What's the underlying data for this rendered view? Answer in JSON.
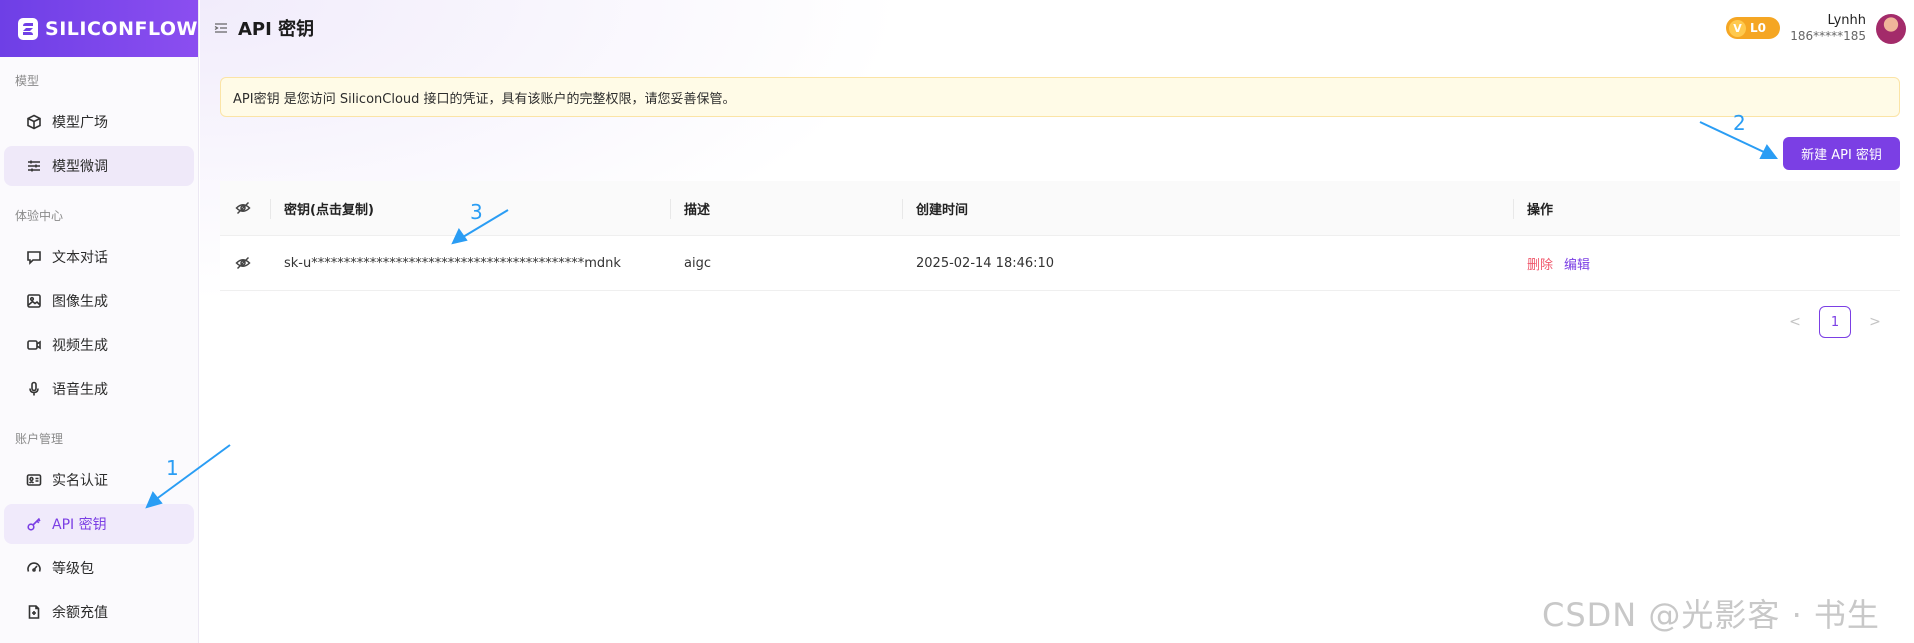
{
  "brand": {
    "name": "SILICONFLOW"
  },
  "sidebar": {
    "sections": [
      {
        "title": "模型",
        "items": [
          {
            "label": "模型广场",
            "icon": "cube-icon"
          },
          {
            "label": "模型微调",
            "icon": "sliders-icon"
          }
        ]
      },
      {
        "title": "体验中心",
        "items": [
          {
            "label": "文本对话",
            "icon": "chat-icon"
          },
          {
            "label": "图像生成",
            "icon": "image-icon"
          },
          {
            "label": "视频生成",
            "icon": "video-icon"
          },
          {
            "label": "语音生成",
            "icon": "mic-icon"
          }
        ]
      },
      {
        "title": "账户管理",
        "items": [
          {
            "label": "实名认证",
            "icon": "id-card-icon"
          },
          {
            "label": "API 密钥",
            "icon": "key-icon"
          },
          {
            "label": "等级包",
            "icon": "gauge-icon"
          },
          {
            "label": "余额充值",
            "icon": "recharge-icon"
          }
        ]
      }
    ]
  },
  "header": {
    "title": "API 密钥",
    "level": {
      "v": "V",
      "label": "L0"
    },
    "user": {
      "name": "Lynhh",
      "phone": "186*****185"
    }
  },
  "alert": {
    "text": "API密钥 是您访问 SiliconCloud 接口的凭证，具有该账户的完整权限，请您妥善保管。"
  },
  "actions": {
    "new_key": "新建 API 密钥"
  },
  "table": {
    "columns": [
      "密钥(点击复制)",
      "描述",
      "创建时间",
      "操作"
    ],
    "rows": [
      {
        "key": "sk-u******************************************mdnk",
        "desc": "aigc",
        "created": "2025-02-14 18:46:10",
        "delete": "删除",
        "edit": "编辑"
      }
    ]
  },
  "pagination": {
    "prev": "<",
    "page": "1",
    "next": ">"
  },
  "annotations": {
    "a1": "1",
    "a2": "2",
    "a3": "3"
  },
  "watermark": "CSDN @光影客 · 书生",
  "colors": {
    "accent": "#7b3fe4",
    "danger": "#f0566a",
    "annotation": "#2a9df4",
    "level": "#f5a623"
  }
}
